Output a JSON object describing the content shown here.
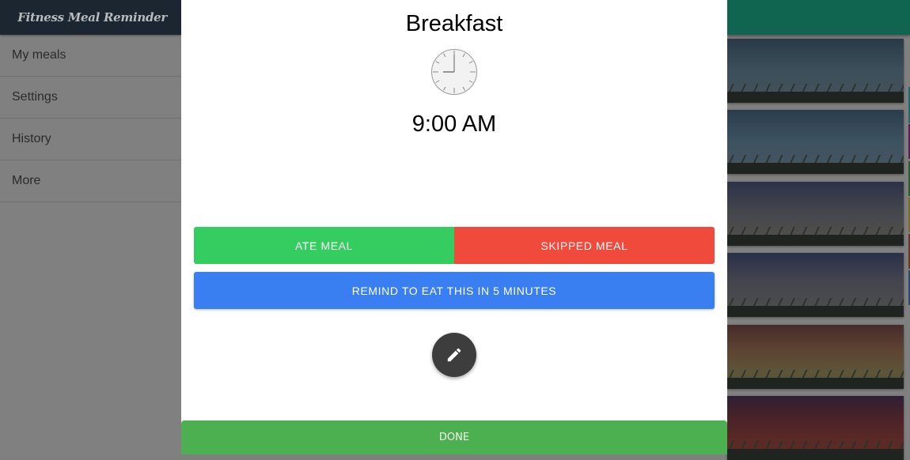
{
  "app": {
    "title": "Fitness Meal Reminder"
  },
  "sidebar": {
    "items": [
      {
        "label": "My meals"
      },
      {
        "label": "Settings"
      },
      {
        "label": "History"
      },
      {
        "label": "More"
      }
    ]
  },
  "modal": {
    "meal_name": "Breakfast",
    "clock_icon": "clock-icon",
    "time": "9:00 AM",
    "ate_label": "ATE MEAL",
    "skipped_label": "SKIPPED MEAL",
    "remind_label": "REMIND TO EAT THIS IN 5 MINUTES",
    "edit_icon": "pencil-icon",
    "done_label": "DONE"
  },
  "colors": {
    "ate": "#35cd60",
    "skipped": "#ef4a3c",
    "remind": "#3a7ff2",
    "done": "#4caf50",
    "header_dark": "#1b2631",
    "header_teal": "#0f6550"
  },
  "background_cards": {
    "count": 6,
    "side_strip_colors": [
      "#808080",
      "#1a6e7a",
      "#6a1a6e",
      "#2a6a2a",
      "#8a7a2a",
      "#7a3a2a",
      "#2a4a7a"
    ]
  }
}
